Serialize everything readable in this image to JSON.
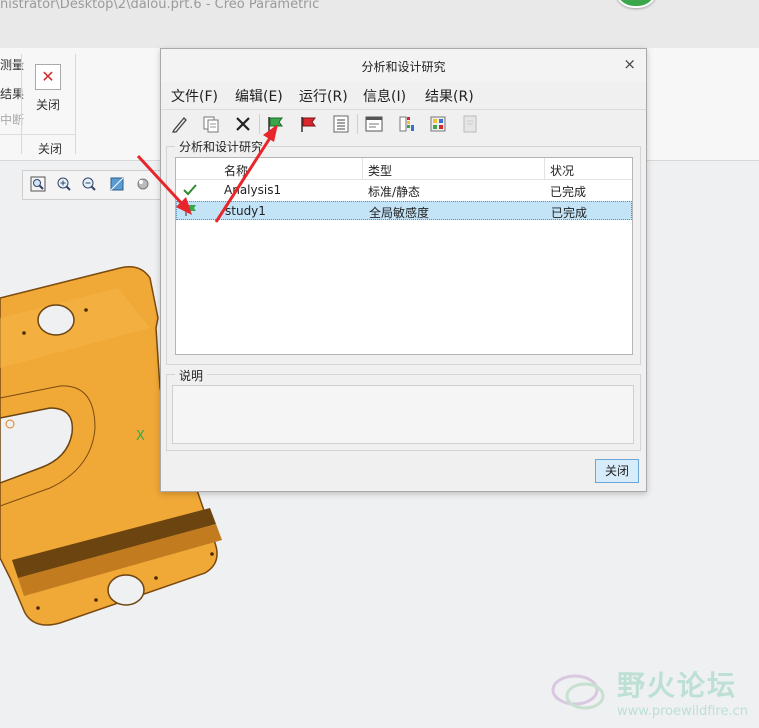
{
  "window": {
    "title": "nistrator\\Desktop\\2\\dalou.prt.6 - Creo Parametric"
  },
  "ribbon": {
    "left_labels": [
      "测量",
      "结果",
      "中断"
    ],
    "close_label": "关闭",
    "group_label": "关闭"
  },
  "dialog": {
    "title": "分析和设计研究",
    "close_x": "×",
    "menu": [
      "文件(F)",
      "编辑(E)",
      "运行(R)",
      "信息(I)",
      "结果(R)"
    ],
    "toolbar_icons": [
      "edit-pencil-icon",
      "copy-icon",
      "delete-icon",
      "start-green-flag-icon",
      "stop-red-flag-icon",
      "status-list-icon",
      "info-window-icon",
      "results-color-icon",
      "results-view-icon",
      "results-disabled-icon"
    ],
    "group_label": "分析和设计研究",
    "columns": [
      "名称",
      "类型",
      "状况"
    ],
    "rows": [
      {
        "icon": "checkmark-icon",
        "name": "Analysis1",
        "type": "标准/静态",
        "status": "已完成"
      },
      {
        "icon": "flag-icon",
        "name": "study1",
        "type": "全局敏感度",
        "status": "已完成"
      }
    ],
    "desc_label": "说明",
    "close_button": "关闭"
  },
  "watermark": {
    "cn": "野火论坛",
    "url": "www.proewildfire.cn"
  },
  "colors": {
    "accent_selection": "#c3e3f7",
    "arrow": "#e8252a",
    "part": "#f0a836"
  }
}
